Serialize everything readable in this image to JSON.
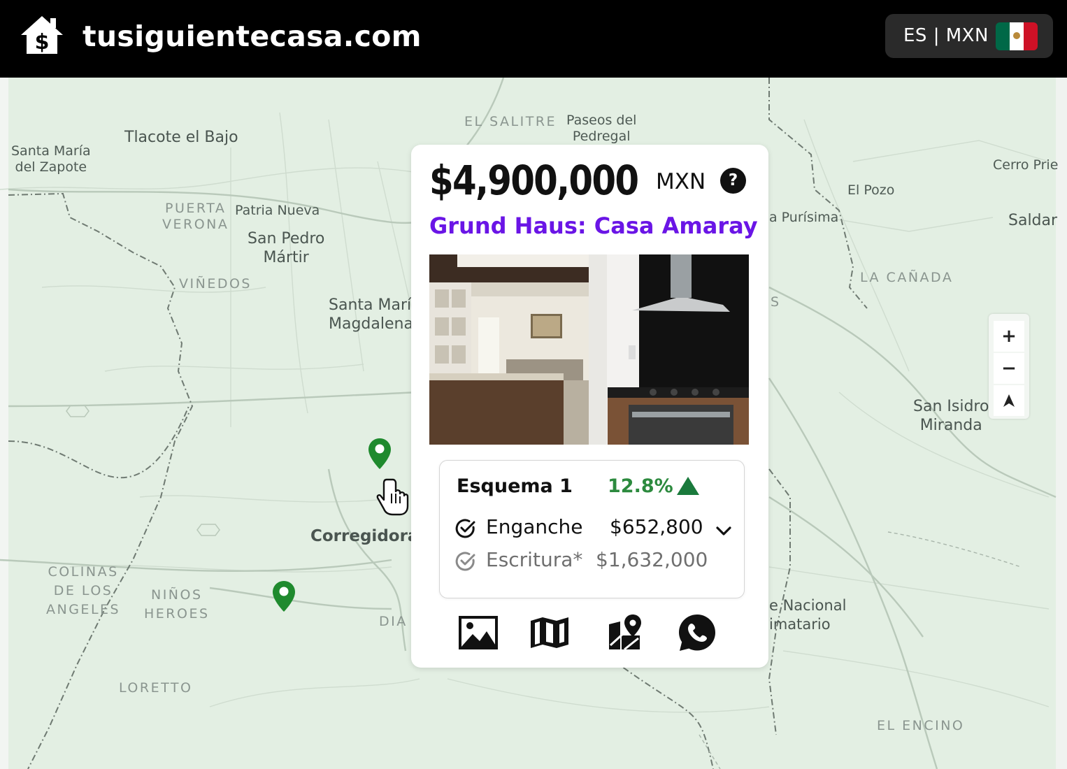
{
  "header": {
    "site_title": "tusiguientecasa.com",
    "language_currency": "ES | MXN",
    "flag_colors": [
      "#006847",
      "#ffffff",
      "#ce1126"
    ]
  },
  "map": {
    "labels": [
      {
        "text": "Santa María\ndel Zapote"
      },
      {
        "text": "Tlacote el Bajo"
      },
      {
        "text": "EL SALITRE"
      },
      {
        "text": "Paseos del\nPedregal"
      },
      {
        "text": "PUERTA\nVERONA"
      },
      {
        "text": "Patria Nueva"
      },
      {
        "text": "San Pedro\nMártir"
      },
      {
        "text": "VIÑEDOS"
      },
      {
        "text": "Santa María\nMagdalena"
      },
      {
        "text": "Cerro Prie"
      },
      {
        "text": "El Pozo"
      },
      {
        "text": "a Purísima"
      },
      {
        "text": "Saldar"
      },
      {
        "text": "LA CAÑADA"
      },
      {
        "text": "San Isidro\nMiranda"
      },
      {
        "text": "Corregidora"
      },
      {
        "text": "COLINAS\nDE LOS\nANGELES"
      },
      {
        "text": "NIÑOS\nHEROES"
      },
      {
        "text": "DIA"
      },
      {
        "text": "LORETTO"
      },
      {
        "text": "e Nacional\nimatario"
      },
      {
        "text": "EL ENCINO"
      },
      {
        "text": "S"
      }
    ],
    "zoom_in_label": "+",
    "zoom_out_label": "−",
    "reset_north_label": "⮝",
    "marker_color": "#1f8a2e"
  },
  "card": {
    "price": "$4,900,000",
    "currency": "MXN",
    "help_label": "?",
    "property_name": "Grund Haus: Casa Amaray",
    "name_color": "#6a15e6",
    "scheme": {
      "title": "Esquema 1",
      "rate": "12.8%",
      "rate_color": "#2c8a3e",
      "rows": [
        {
          "label": "Enganche",
          "value": "$652,800"
        },
        {
          "label": "Escritura*",
          "value": "$1,632,000"
        }
      ]
    },
    "actions": [
      "gallery-icon",
      "map-icon",
      "location-map-icon",
      "whatsapp-icon"
    ]
  }
}
